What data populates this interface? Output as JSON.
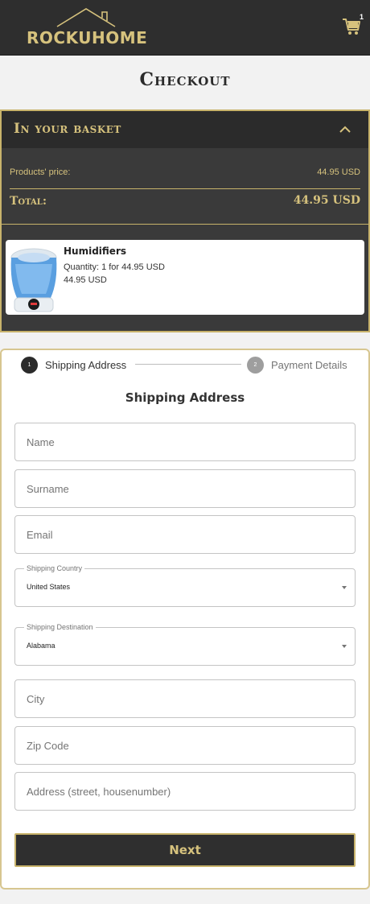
{
  "header": {
    "brand": "ROCKUHOME",
    "cart_count": "1",
    "cart_icon": "shopping-cart-icon",
    "accent": "#d6c27d",
    "background": "#2e2e2e"
  },
  "page": {
    "title": "Checkout"
  },
  "basket": {
    "title": "In your basket",
    "toggle_icon": "chevron-up-icon",
    "products_price_label": "Products' price:",
    "products_price_value": "44.95 USD",
    "total_label": "Total:",
    "total_value": "44.95 USD",
    "items": [
      {
        "name": "Humidifiers",
        "quantity_text": "Quantity: 1 for 44.95 USD",
        "price_text": "44.95 USD",
        "image_icon": "humidifier-image"
      }
    ]
  },
  "steps": {
    "items": [
      {
        "number": "1",
        "label": "Shipping Address",
        "active": true,
        "color": "#2b2b2b"
      },
      {
        "number": "2",
        "label": "Payment Details",
        "active": false,
        "color": "#9e9e9e"
      }
    ]
  },
  "form": {
    "title": "Shipping Address",
    "name_placeholder": "Name",
    "surname_placeholder": "Surname",
    "email_placeholder": "Email",
    "country_label": "Shipping Country",
    "country_value": "United States",
    "destination_label": "Shipping Destination",
    "destination_value": "Alabama",
    "city_placeholder": "City",
    "zip_placeholder": "Zip Code",
    "address_placeholder": "Address (street, housenumber)",
    "next_label": "Next"
  }
}
